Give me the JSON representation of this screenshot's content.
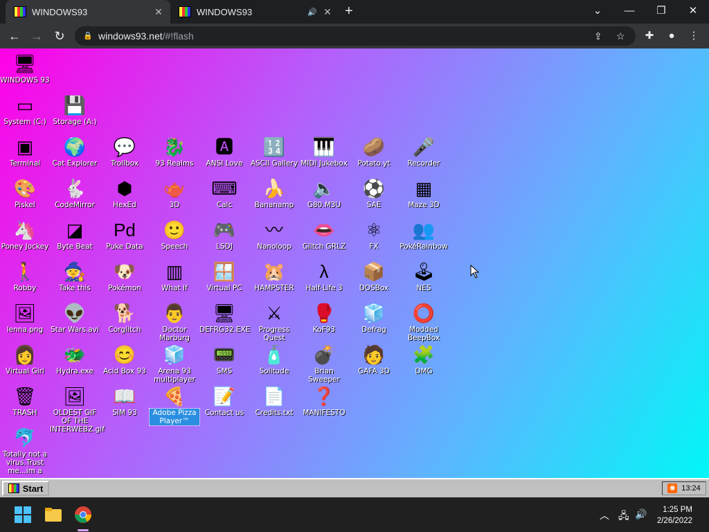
{
  "browser": {
    "tabs": [
      {
        "title": "WINDOWS93",
        "active": true
      },
      {
        "title": "WINDOWS93",
        "active": false
      }
    ],
    "url_host": "windows93.net",
    "url_path": "/#!flash",
    "icons": {
      "back": "arrow-left",
      "forward": "arrow-right",
      "reload": "reload",
      "lock": "lock",
      "share": "share",
      "star": "star",
      "extensions": "puzzle",
      "profile": "person",
      "menu": "kebab"
    }
  },
  "desktop": {
    "icons": [
      {
        "label": "WINDOWS 93",
        "glyph": "🖥"
      },
      {
        "label": "System (C:)",
        "glyph": "▭"
      },
      {
        "label": "Storage (A:)",
        "glyph": "💾"
      },
      {
        "label": "Terminal",
        "glyph": "▣"
      },
      {
        "label": "Cat Explorer",
        "glyph": "🌍"
      },
      {
        "label": "Trollbox",
        "glyph": "💬"
      },
      {
        "label": "93 Realms",
        "glyph": "🐉"
      },
      {
        "label": "ANSI Love",
        "glyph": "🅰"
      },
      {
        "label": "ASCII Gallery",
        "glyph": "🔢"
      },
      {
        "label": "MIDI Jukebox",
        "glyph": "🎹"
      },
      {
        "label": "Potato.yt",
        "glyph": "🥔"
      },
      {
        "label": "Recorder",
        "glyph": "🎤"
      },
      {
        "label": "Piskel",
        "glyph": "🎨"
      },
      {
        "label": "CodeMirror",
        "glyph": "🐇"
      },
      {
        "label": "HexEd",
        "glyph": "⬢"
      },
      {
        "label": "3D",
        "glyph": "🫖"
      },
      {
        "label": "Calc",
        "glyph": "⌨"
      },
      {
        "label": "Bananamp",
        "glyph": "🍌"
      },
      {
        "label": "G80.M3U",
        "glyph": "🔈"
      },
      {
        "label": "SAE",
        "glyph": "⚽"
      },
      {
        "label": "Maze 3D",
        "glyph": "▦"
      },
      {
        "label": "Poney Jockey",
        "glyph": "🦄"
      },
      {
        "label": "Byte Beat",
        "glyph": "◪"
      },
      {
        "label": "Puke Data",
        "glyph": "Pd"
      },
      {
        "label": "Speech",
        "glyph": "🙂"
      },
      {
        "label": "LSDJ",
        "glyph": "🎮"
      },
      {
        "label": "Nanoloop",
        "glyph": "〰"
      },
      {
        "label": "Glitch GRLZ",
        "glyph": "👄"
      },
      {
        "label": "FX",
        "glyph": "⚛"
      },
      {
        "label": "PokéRainbow",
        "glyph": "👥"
      },
      {
        "label": "Robby",
        "glyph": "🚶"
      },
      {
        "label": "Take this",
        "glyph": "🧙"
      },
      {
        "label": "Pokémon",
        "glyph": "🐶"
      },
      {
        "label": "What If",
        "glyph": "▥"
      },
      {
        "label": "Virtual PC",
        "glyph": "🪟"
      },
      {
        "label": "HAMPSTER",
        "glyph": "🐹"
      },
      {
        "label": "Half-Life 3",
        "glyph": "λ"
      },
      {
        "label": "DOSBox",
        "glyph": "📦"
      },
      {
        "label": "NES",
        "glyph": "🕹"
      },
      {
        "label": "lenna.png",
        "glyph": "🖼"
      },
      {
        "label": "Star Wars.avi",
        "glyph": "👽"
      },
      {
        "label": "Corglitch",
        "glyph": "🐕"
      },
      {
        "label": "Doctor Marburg",
        "glyph": "👨"
      },
      {
        "label": "DEFRG32.EXE",
        "glyph": "🖥"
      },
      {
        "label": "Progress Quest",
        "glyph": "⚔"
      },
      {
        "label": "KoF93",
        "glyph": "🥊"
      },
      {
        "label": "Defrag",
        "glyph": "🧊"
      },
      {
        "label": "Modded BeepBox",
        "glyph": "⭕"
      },
      {
        "label": "Virtual Girl",
        "glyph": "👩"
      },
      {
        "label": "Hydra.exe",
        "glyph": "🐲"
      },
      {
        "label": "Acid Box 93",
        "glyph": "😊"
      },
      {
        "label": "Arena 93 multiplayer",
        "glyph": "🧊"
      },
      {
        "label": "SMS",
        "glyph": "📟"
      },
      {
        "label": "Solitude",
        "glyph": "🧴"
      },
      {
        "label": "Brian Sweeper",
        "glyph": "💣"
      },
      {
        "label": "GAFA 3D",
        "glyph": "🧑"
      },
      {
        "label": "DMG",
        "glyph": "🧩"
      },
      {
        "label": "TRASH",
        "glyph": "🗑"
      },
      {
        "label": "OLDEST GIF OF THE INTERWEBZ.gif",
        "glyph": "🖼"
      },
      {
        "label": "SIM 93",
        "glyph": "📖"
      },
      {
        "label": "Adobe Pizza Player™",
        "glyph": "🍕",
        "selected": true
      },
      {
        "label": "Contact us",
        "glyph": "📝"
      },
      {
        "label": "Credits.txt",
        "glyph": "📄"
      },
      {
        "label": "MANIFESTO",
        "glyph": "❓"
      },
      {
        "label": "Totally not a virus.Trust me...im a dolphin",
        "glyph": "🐬"
      }
    ]
  },
  "w93taskbar": {
    "start_label": "Start",
    "clock": "13:24"
  },
  "windows": {
    "time": "1:25 PM",
    "date": "2/26/2022"
  }
}
